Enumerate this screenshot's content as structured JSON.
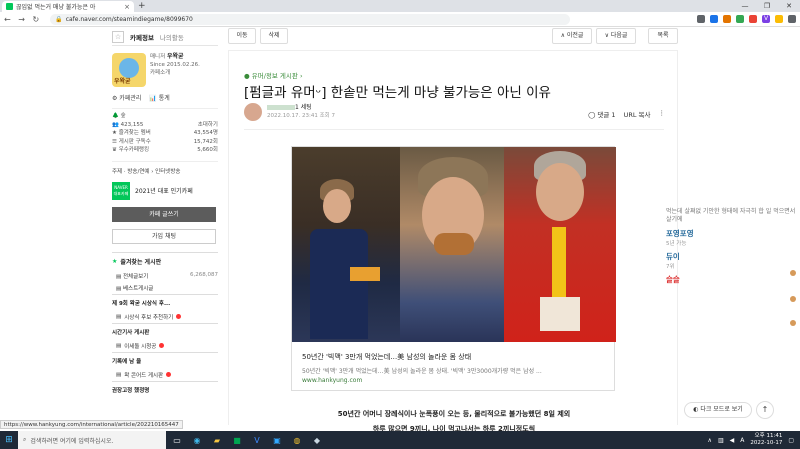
{
  "browser": {
    "tab_title": "끊임없 먹는거 매냥 불가능은 아",
    "tab_close": "×",
    "new_tab": "+",
    "url": "cafe.naver.com/steamindiegame/8099670",
    "window_controls": [
      "—",
      "❐",
      "✕"
    ],
    "extensions": [
      {
        "label": "",
        "color": "#5f6368"
      },
      {
        "label": "",
        "color": "#1a73e8"
      },
      {
        "label": "",
        "color": "#e37400"
      },
      {
        "label": "",
        "color": "#34a853"
      },
      {
        "label": "",
        "color": "#ea4335"
      },
      {
        "label": "V",
        "color": "#7b3fe4"
      },
      {
        "label": "",
        "color": "#fbbc04"
      },
      {
        "label": "",
        "color": "#5f6368"
      }
    ]
  },
  "sidebar": {
    "tab_info": "카페정보",
    "tab_activity": "나의활동",
    "manager_label": "매니저",
    "manager_name": "우왁굳",
    "since": "Since 2015.02.26.",
    "cafe_intro": "카페소개",
    "avatar_text": "우왁굳",
    "link_manage": "카페관리",
    "link_stats": "통계",
    "level_label": "숲",
    "member_count": "423,155",
    "invite": "초대하기",
    "stats": [
      {
        "label": "즐겨찾는 멤버",
        "value": "43,554명"
      },
      {
        "label": "게시판 구독수",
        "value": "15,742회"
      },
      {
        "label": "우수카페랭킹",
        "value": "5,660회"
      }
    ],
    "topic": "주제 · 방송/연예 › 인터넷방송",
    "award_badge": "NAVER 대표카페",
    "award_text": "2021년 대표 인기카페",
    "write_button": "카페 글쓰기",
    "join_button": "가입 채팅",
    "fav_board_title": "즐겨찾는 게시판",
    "fav_boards": [
      {
        "name": "전체글보기",
        "count": "6,268,087"
      },
      {
        "name": "베스트게시글",
        "count": ""
      }
    ],
    "sections": [
      {
        "title": "제 9회 왁굳 시상식 후...",
        "item": "시상식 후보 추천하기"
      },
      {
        "title": "시간기사 게시판",
        "item": "이세돌 시청공"
      },
      {
        "title": "기록에 남 을",
        "item": "왁 콘어드 게시판"
      }
    ],
    "cut_label": "권장고정 했정명"
  },
  "article": {
    "btn_move": "이동",
    "btn_delete": "삭제",
    "btn_prev": "이전글",
    "btn_next": "다음글",
    "btn_list": "목록",
    "board": "유머/정보 게시판",
    "title": "[펌글과 유머ᵕ] 한솥만 먹는게 마냥 불가능은 아닌 이유",
    "author_suffix": "1 세팅",
    "date": "2022.10.17. 23:41  조회 7",
    "comments": "댓글 1",
    "url_copy": "URL 복사",
    "card_title": "50년간 '빅맥' 3만개 먹었는데…美 남성의 놀라운 몸 상태",
    "card_desc": "50년간 '빅맥' 3만개 먹었는데…美 남성의 놀라운 몸 상태. '빅맥' 3만3000개가량 먹은 남성 ...",
    "card_url": "www.hankyung.com",
    "body_line1": "50년간 어머니 장례식이나 눈폭풍이 오는 등, 물리적으로 불가능했던 8일 제외",
    "body_line2": "하루 많으면 9끼니, 나이 먹고나서는 하루 2끼니정도씩"
  },
  "right_panel": {
    "snippet": "먹는데 살쪄없 기안한 형태에 자극히 합 일 먹으면서 살기에",
    "entries": [
      {
        "name": "포영포영",
        "sub": "5년 가능"
      },
      {
        "name": "듀이",
        "sub": "7위"
      },
      {
        "name": "슬슬",
        "sub": ""
      }
    ],
    "dark_mode": "다크 모드로 보기",
    "to_top": "↑"
  },
  "status_url": "https://www.hankyung.com/international/article/202210165447",
  "taskbar": {
    "search_placeholder": "검색하려면 여기에 입력하십시오.",
    "time": "오후 11:41",
    "date": "2022-10-17"
  }
}
